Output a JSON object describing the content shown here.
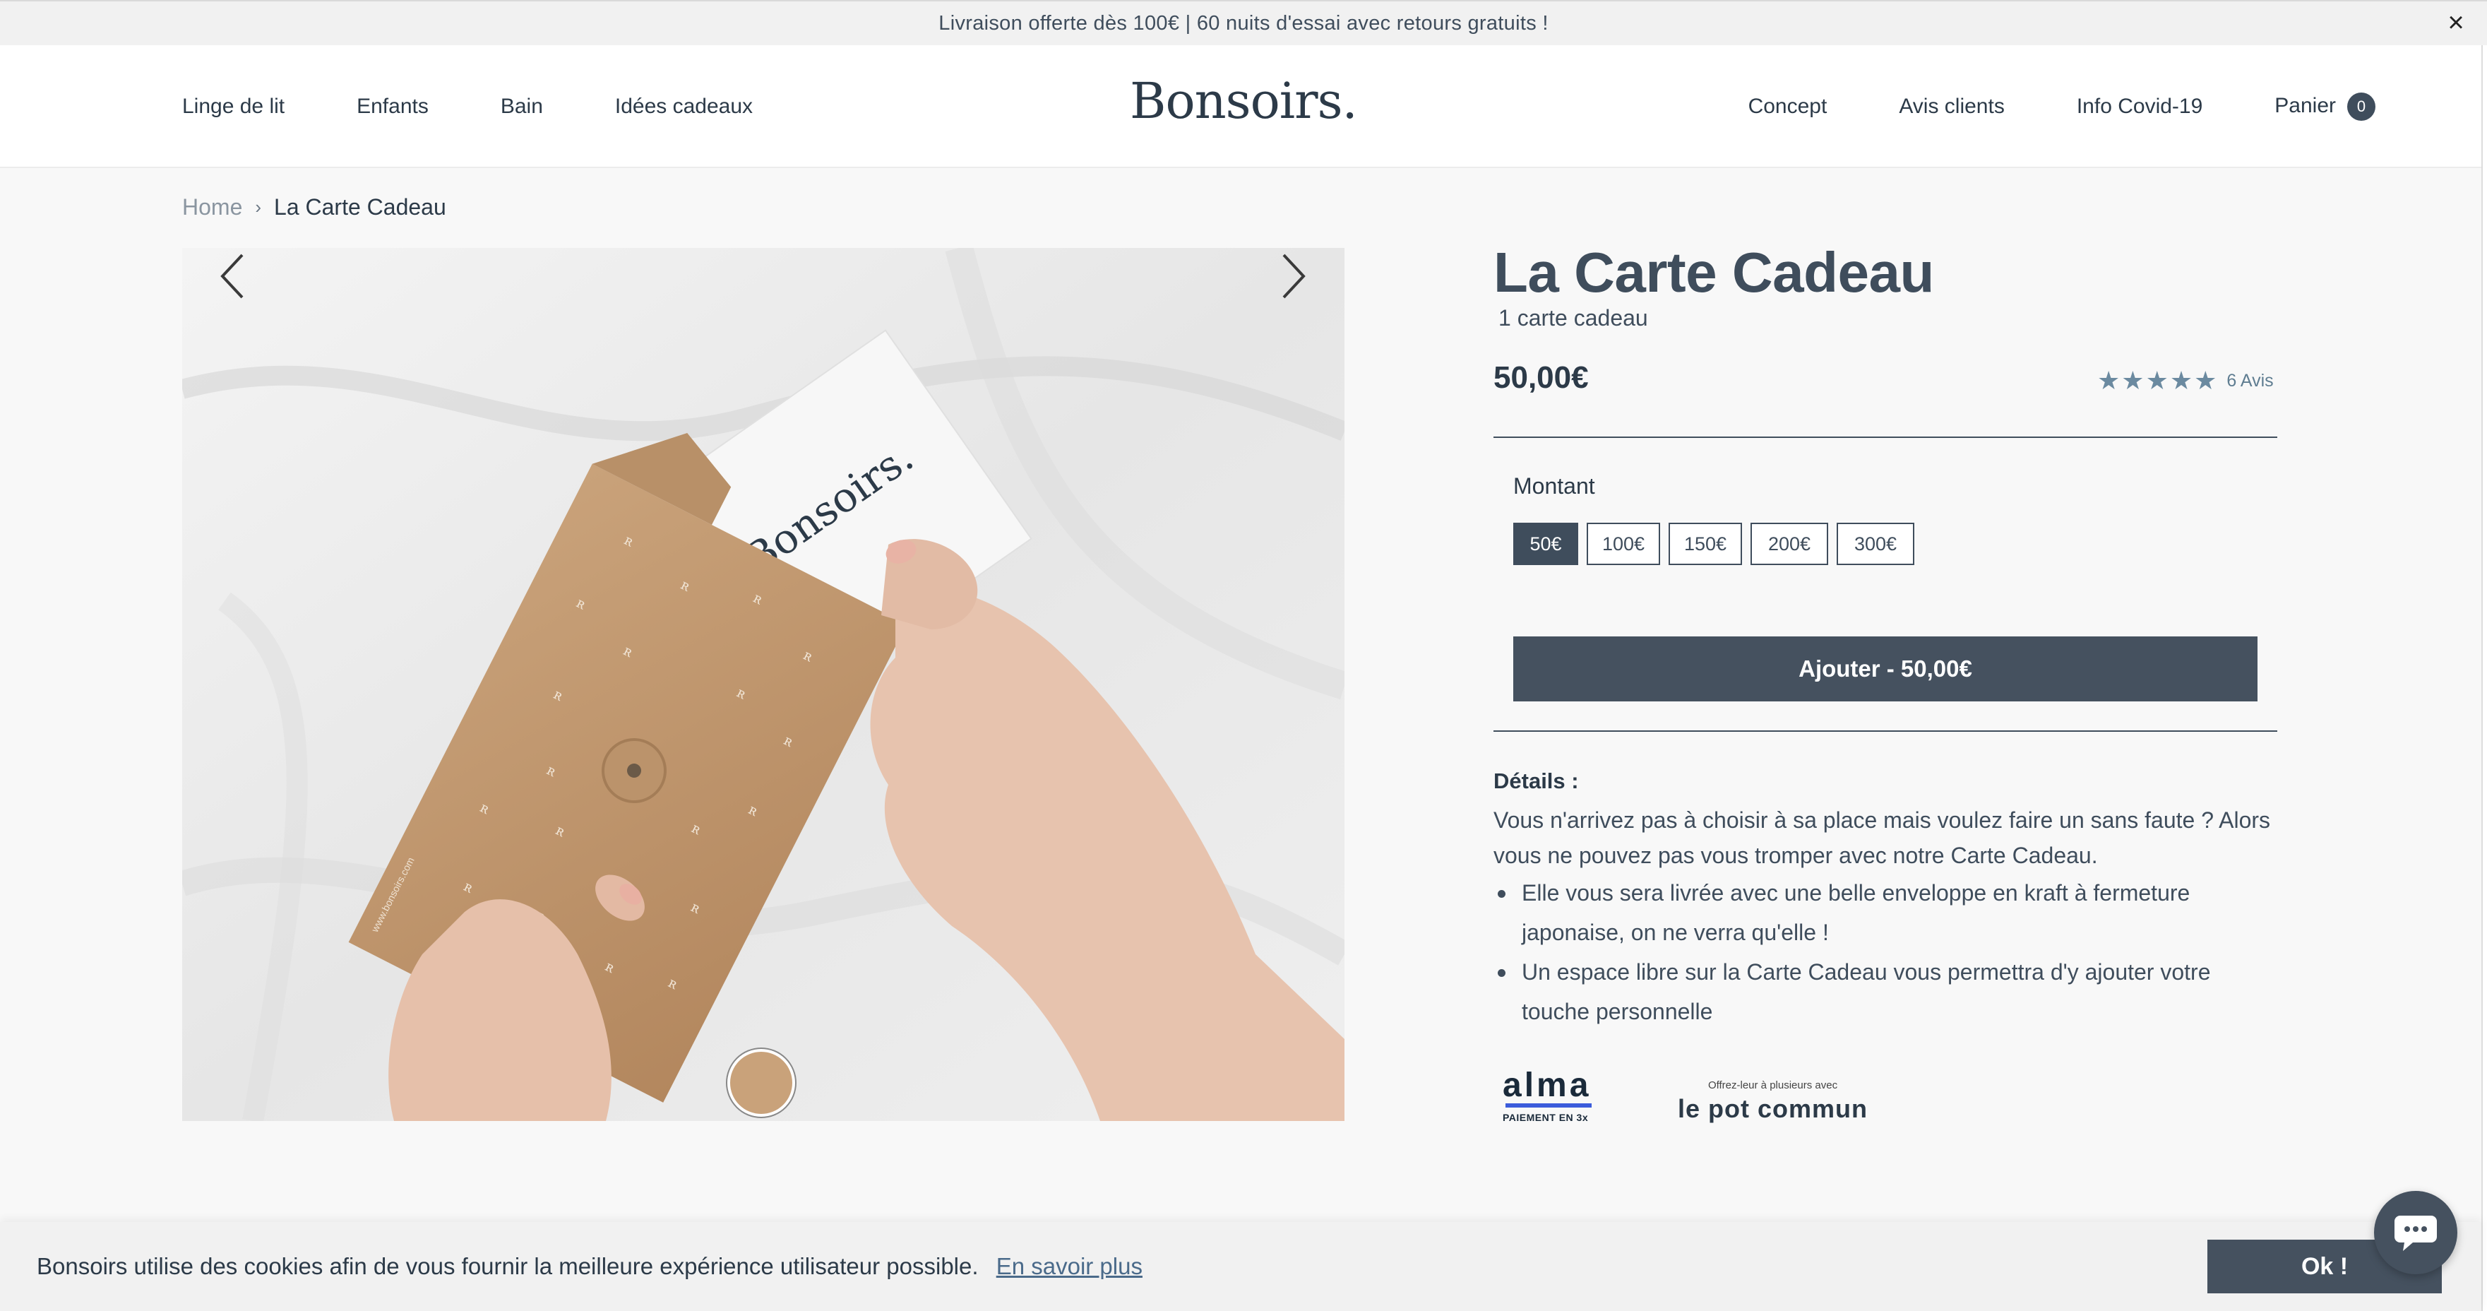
{
  "announcement": {
    "text": "Livraison offerte dès 100€ | 60 nuits d'essai avec retours gratuits !",
    "close": "×"
  },
  "header": {
    "logo": "Bonsoirs.",
    "nav_left": [
      "Linge de lit",
      "Enfants",
      "Bain",
      "Idées cadeaux"
    ],
    "nav_right": [
      "Concept",
      "Avis clients",
      "Info Covid-19"
    ],
    "cart_label": "Panier",
    "cart_count": "0"
  },
  "breadcrumb": {
    "home": "Home",
    "separator": "›",
    "current": "La Carte Cadeau"
  },
  "gallery": {
    "envelope_text": "Bonsoirs.",
    "envelope_url": "www.bonsoirs.com"
  },
  "product": {
    "title": "La Carte Cadeau",
    "subtitle": "1 carte cadeau",
    "price": "50,00€",
    "rating": 5,
    "reviews": "6 Avis",
    "amount_label": "Montant",
    "amounts": [
      "50€",
      "100€",
      "150€",
      "200€",
      "300€"
    ],
    "selected_amount": "50€",
    "add_button": "Ajouter - 50,00€",
    "details_title": "Détails :",
    "details_text": "Vous n'arrivez pas à choisir à sa place mais voulez faire un sans faute ? Alors vous ne pouvez pas vous tromper avec notre Carte Cadeau.",
    "details_bullets": [
      "Elle vous sera livrée avec une belle enveloppe en kraft à fermeture japonaise, on ne verra qu'elle !",
      "Un espace libre sur la Carte Cadeau vous permettra d'y ajouter votre touche personnelle"
    ]
  },
  "payment": {
    "alma_word": "alma",
    "alma_sub": "PAIEMENT EN 3x",
    "potcommun_small": "Offrez-leur à plusieurs avec",
    "potcommun_big": "le pot commun"
  },
  "cookie": {
    "text": "Bonsoirs utilise des cookies afin de vous fournir la meilleure expérience utilisateur possible.",
    "link": "En savoir plus",
    "ok": "Ok !"
  },
  "colors": {
    "primary": "#45515f",
    "text": "#3f4d5c",
    "star": "#6b8aa0",
    "alma_blue": "#3b5cdb"
  },
  "icons": {
    "close": "close-icon",
    "prev": "chevron-left-icon",
    "next": "chevron-right-icon",
    "star": "star-icon",
    "chat": "chat-icon"
  }
}
